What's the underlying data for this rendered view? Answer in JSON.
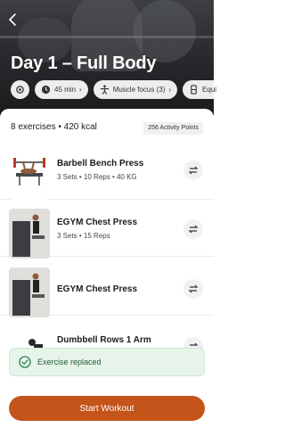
{
  "header": {
    "back_icon": "chevron-left-icon",
    "title": "Day 1 – Full Body"
  },
  "chips": [
    {
      "icon": "settings-icon",
      "label": ""
    },
    {
      "icon": "clock-icon",
      "label": "45 min"
    },
    {
      "icon": "body-icon",
      "label": "Muscle focus (3)"
    },
    {
      "icon": "equipment-icon",
      "label": "Equi"
    }
  ],
  "summary": {
    "text": "8 exercises • 420 kcal",
    "points": "256 Activity Points"
  },
  "exercises": [
    {
      "name": "Barbell Bench Press",
      "meta": "3 Sets • 10 Reps • 40 KG"
    },
    {
      "name": "EGYM Chest Press",
      "meta": "3 Sets • 15 Reps"
    },
    {
      "name": "EGYM Chest Press",
      "meta": ""
    },
    {
      "name": "Dumbbell Rows 1 Arm",
      "meta": ""
    }
  ],
  "toast": {
    "icon": "check-circle-icon",
    "text": "Exercise replaced"
  },
  "cta": {
    "label": "Start Workout"
  },
  "colors": {
    "accent": "#c5541a",
    "toast_bg": "#e6f4ea",
    "toast_text": "#1e5c36"
  }
}
